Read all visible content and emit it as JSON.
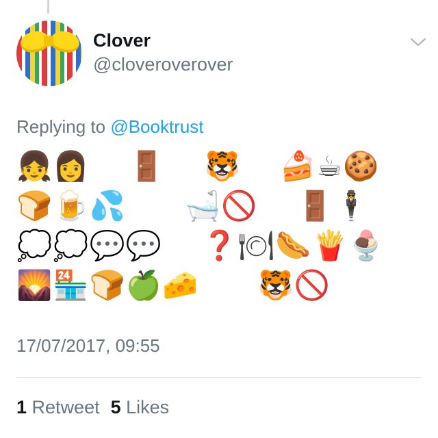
{
  "tweet": {
    "author": {
      "name": "Clover",
      "handle": "@cloveroverover"
    },
    "reply": {
      "prefix": "Replying to ",
      "mention": "@Booktrust"
    },
    "emoji_lines": [
      "👧👩    🚪    🐯    🍰☕🍪",
      "🍞🍺💦      🛁🚫    🚪🕴",
      "💭💭💬💬    ❓🍽🌭🍟🍨",
      "🌄🏪🍞🍏🧀      🐯🚫"
    ],
    "timestamp": "17/07/2017, 09:55",
    "stats": {
      "retweet_count": "1",
      "retweet_label": "Retweet",
      "like_count": "5",
      "like_label": "Likes"
    }
  },
  "icons": {
    "menu": "chevron-down-icon"
  },
  "colors": {
    "primary_text": "#14171a",
    "secondary_text": "#657786",
    "link": "#1da1f2",
    "divider": "#e1e8ed"
  }
}
